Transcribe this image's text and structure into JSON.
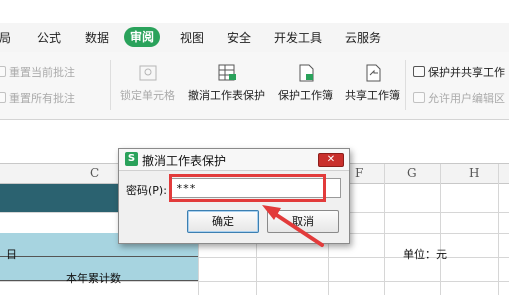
{
  "menu": {
    "tabs": [
      "局",
      "公式",
      "数据",
      "审阅",
      "视图",
      "安全",
      "开发工具",
      "云服务"
    ],
    "active": "审阅"
  },
  "ribbon": {
    "comment_delete_current": "重置当前批注",
    "comment_delete_all": "重置所有批注",
    "lock_cell": "锁定单元格",
    "unprotect_sheet": "撤消工作表保护",
    "protect_workbook": "保护工作簿",
    "share_workbook": "共享工作簿",
    "protect_and_share": "保护并共享工作",
    "allow_edit_ranges": "允许用户编辑区"
  },
  "sheet": {
    "columns": [
      "C",
      "F",
      "G",
      "H"
    ],
    "cell_day": "日",
    "cell_unit": "单位：元",
    "cell_cumulative": "本年累计数"
  },
  "dialog": {
    "title": "撤消工作表保护",
    "logo": "S",
    "close_icon": "close-icon",
    "password_label": "密码(P):",
    "password_value": "***",
    "ok_label": "确定",
    "cancel_label": "取消"
  },
  "colors": {
    "accent_green": "#2aa25b",
    "highlight_red": "#e23b3b",
    "header_dark": "#2b6270",
    "header_light": "#a7d4e0"
  }
}
